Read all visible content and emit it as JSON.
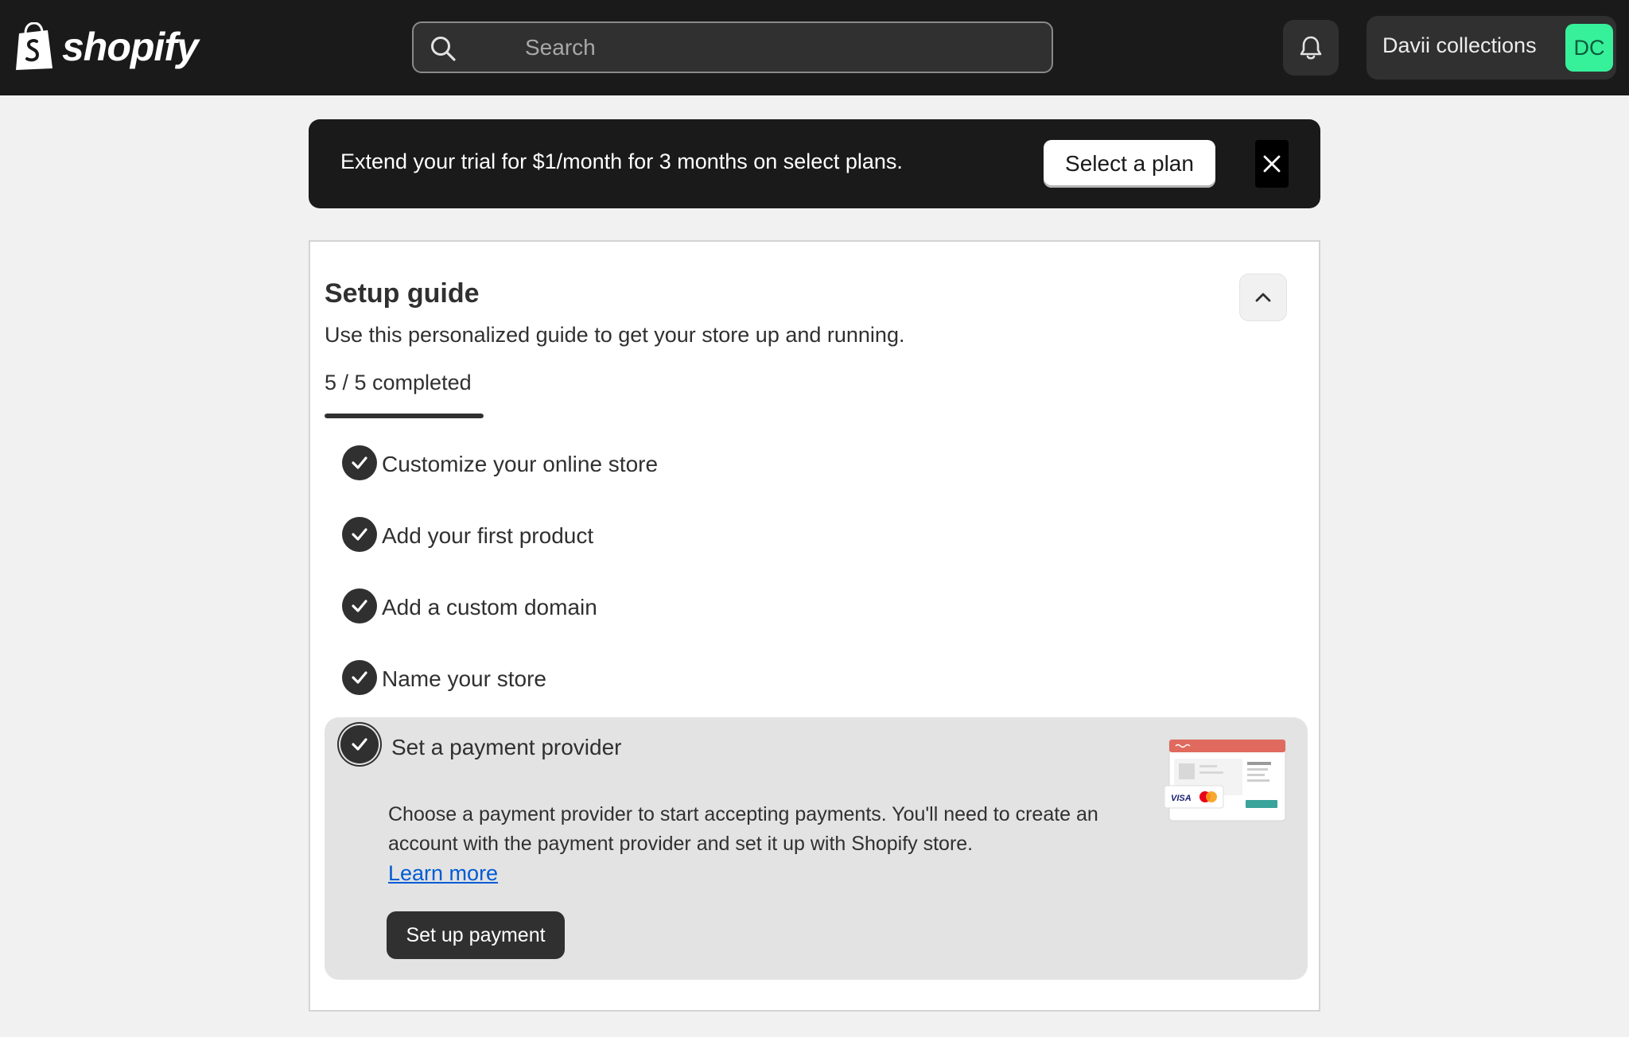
{
  "topbar": {
    "logo_text": "shopify",
    "search": {
      "placeholder": "Search",
      "value": ""
    },
    "icons": {
      "logo": "shopify-bag-icon",
      "search": "search-icon",
      "notifications": "bell-icon"
    },
    "store": {
      "name": "Davii collections",
      "avatar_initials": "DC",
      "avatar_color": "#36f09a"
    }
  },
  "banner": {
    "text": "Extend your trial for $1/month for 3 months on select plans.",
    "button_label": "Select a plan",
    "close_icon": "close-icon"
  },
  "setup_guide": {
    "title": "Setup guide",
    "subtitle": "Use this personalized guide to get your store up and running.",
    "progress_text": "5 / 5 completed",
    "progress_fraction": 1.0,
    "collapse_icon": "chevron-up-icon",
    "tasks": [
      {
        "label": "Customize your online store",
        "completed": true
      },
      {
        "label": "Add your first product",
        "completed": true
      },
      {
        "label": "Add a custom domain",
        "completed": true
      },
      {
        "label": "Name your store",
        "completed": true
      },
      {
        "label": "Set a payment provider",
        "completed": true,
        "expanded": true,
        "description": "Choose a payment provider to start accepting payments. You'll need to create an account with the payment provider and set it up with Shopify store.",
        "link_label": "Learn more",
        "button_label": "Set up payment",
        "illustration_labels": {
          "card_brand": "VISA"
        }
      }
    ]
  },
  "colors": {
    "topbar_bg": "#1a1a1a",
    "accent_link": "#005bd3",
    "primary_button": "#303030",
    "page_bg": "#f1f1f1"
  }
}
